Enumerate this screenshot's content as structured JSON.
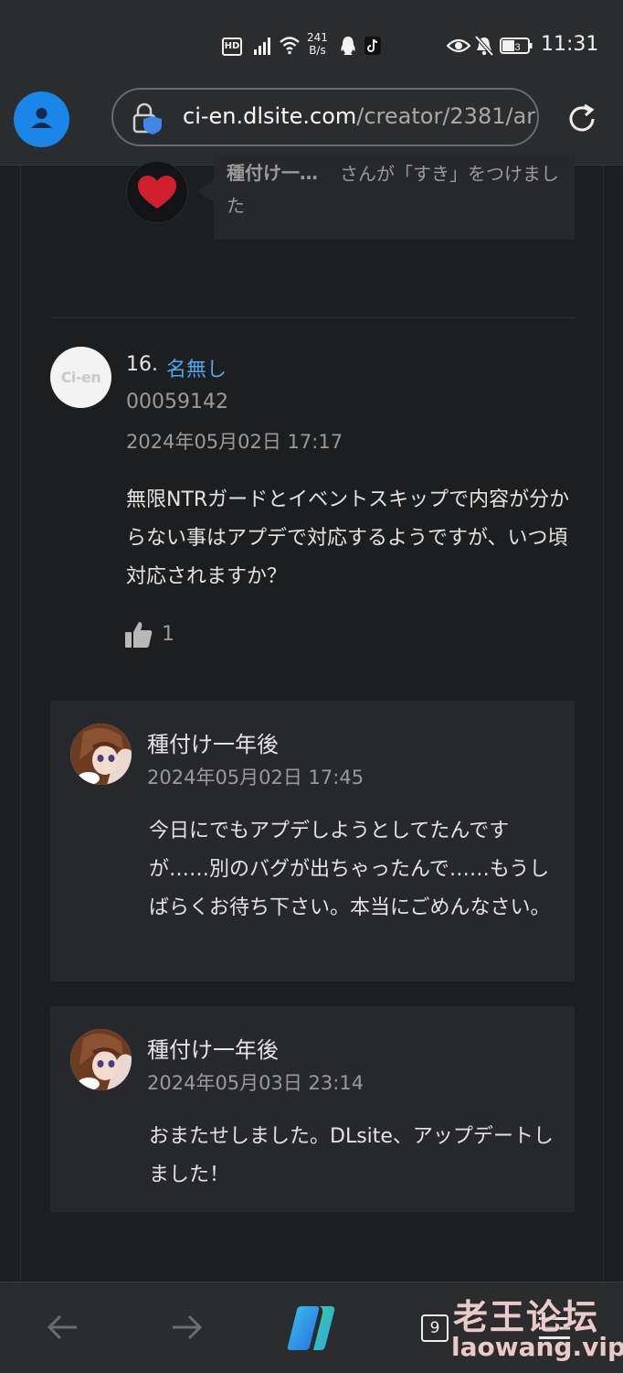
{
  "status_bar": {
    "hd": "HD",
    "net_speed_value": "241",
    "net_speed_unit": "B/s",
    "battery": "43",
    "time": "11:31"
  },
  "browser": {
    "url_host": "ci-en.dlsite.com",
    "url_path": "/creator/2381/ar"
  },
  "like_notice": {
    "user": "種付け一…",
    "text": "さんが「すき」をつけました"
  },
  "comment": {
    "number": "16.",
    "author": "名無し",
    "avatar_text": "Ci-en",
    "user_id": "00059142",
    "date": "2024年05月02日 17:17",
    "body": "無限NTRガードとイベントスキップで内容が分からない事はアプデで対応するようですが、いつ頃対応されますか？",
    "likes": "1"
  },
  "replies": [
    {
      "author": "種付け一年後",
      "date": "2024年05月02日 17:45",
      "body": "今日にでもアプデしようとしてたんですが……別のバグが出ちゃったんで……もうしばらくお待ち下さい。本当にごめんなさい。"
    },
    {
      "author": "種付け一年後",
      "date": "2024年05月03日 23:14",
      "body": "おまたせしました。DLsite、アップデートしました！"
    }
  ],
  "bottom_nav": {
    "tab_count": "9"
  },
  "watermark": {
    "title": "老王论坛",
    "url": "laowang.vip"
  },
  "colors": {
    "accent_link": "#4fa8f0",
    "avatar_button": "#1a86e8",
    "heart": "#d0202e"
  }
}
